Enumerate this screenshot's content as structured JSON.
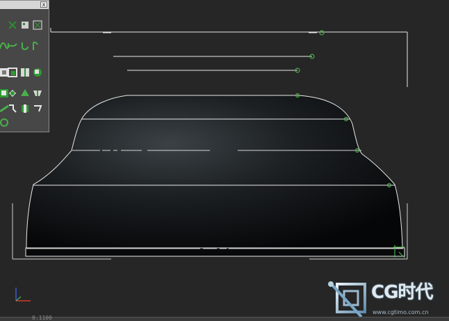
{
  "toolbar": {
    "close_glyph": "x",
    "buttons": [
      {
        "name": "soft-selection-icon"
      },
      {
        "name": "snap-icon"
      },
      {
        "name": "grid-snap-icon"
      },
      {
        "name": "bezier-icon"
      },
      {
        "name": "curve-icon"
      },
      {
        "name": "hook-icon"
      },
      {
        "name": "fillet-icon"
      },
      {
        "name": "surface-icon"
      },
      {
        "name": "copy-surface-icon"
      },
      {
        "name": "extrude-icon"
      },
      {
        "name": "blend-icon"
      },
      {
        "name": "loft-icon"
      },
      {
        "name": "cap-icon"
      },
      {
        "name": "lathe-icon"
      },
      {
        "name": "chamfer-icon"
      },
      {
        "name": "mirror-icon"
      },
      {
        "name": "sweep-icon"
      },
      {
        "name": "trim-icon"
      },
      {
        "name": "break-icon"
      },
      {
        "name": "normal-icon"
      }
    ]
  },
  "status": {
    "readout": "0.1100"
  },
  "watermark": {
    "brand": "CG时代",
    "url": "www.cgtimo.com.cn"
  },
  "viewport": {
    "axis_x_color": "#d23a2a",
    "axis_y_color": "#3a5ad8",
    "curve_color": "#e9e9e9",
    "handle_color": "#49b04a",
    "surface_dark": "#050607"
  }
}
